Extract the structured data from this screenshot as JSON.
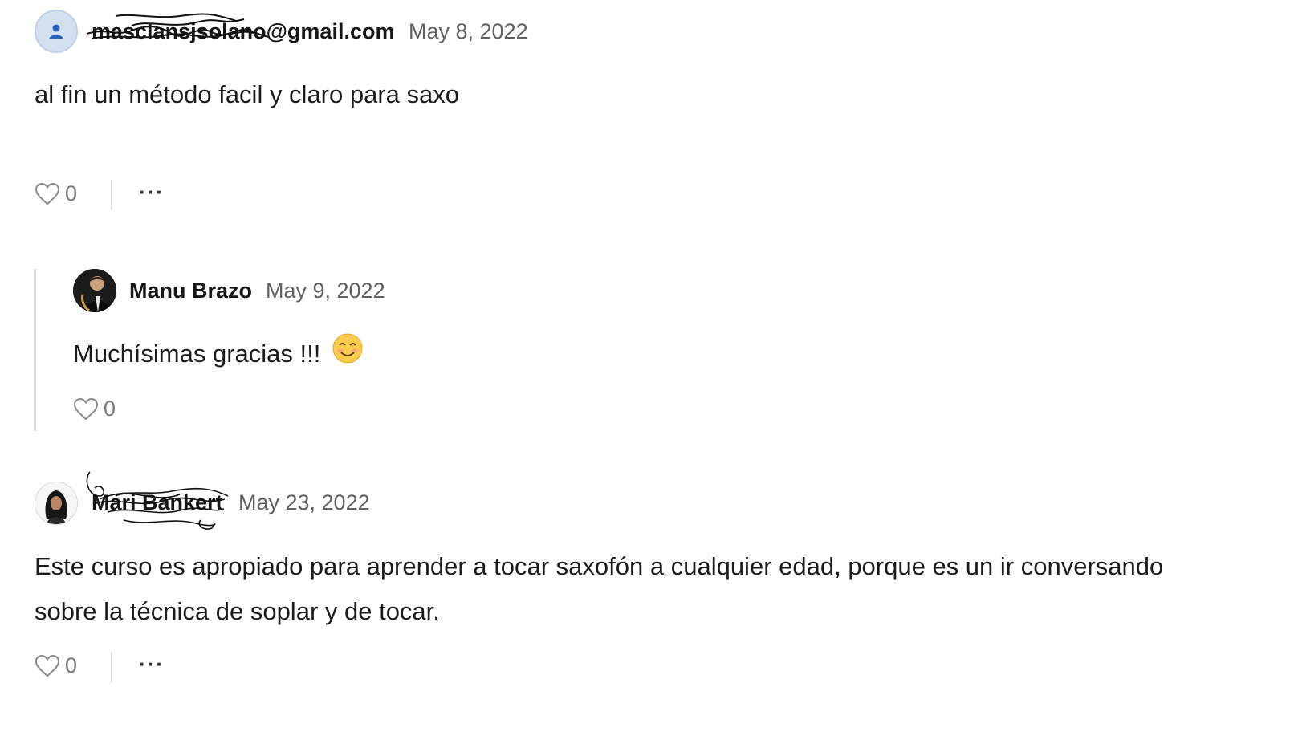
{
  "comments": [
    {
      "author": "masclansjsolano@gmail.com",
      "date": "May 8, 2022",
      "text": "al fin un método facil y claro para saxo",
      "likes": "0",
      "more_label": "···"
    },
    {
      "author": "Manu Brazo",
      "date": "May 9, 2022",
      "text": "Muchísimas gracias !!!",
      "likes": "0"
    },
    {
      "author": "Mari Bankert",
      "date": "May 23, 2022",
      "text_line1": "Este curso es apropiado para aprender a tocar saxofón a cualquier edad, porque es un ir conversando",
      "text_line2": "sobre la técnica de soplar y de tocar.",
      "likes": "0",
      "more_label": "···"
    }
  ],
  "icons": {
    "like": "heart-outline-icon",
    "more": "more-dots-icon",
    "emoji": "smiling-face-emoji"
  },
  "colors": {
    "default_avatar_bg": "#d3e0f0",
    "default_avatar_icon": "#2a63b8",
    "date": "#606060",
    "divider": "#dedede"
  }
}
